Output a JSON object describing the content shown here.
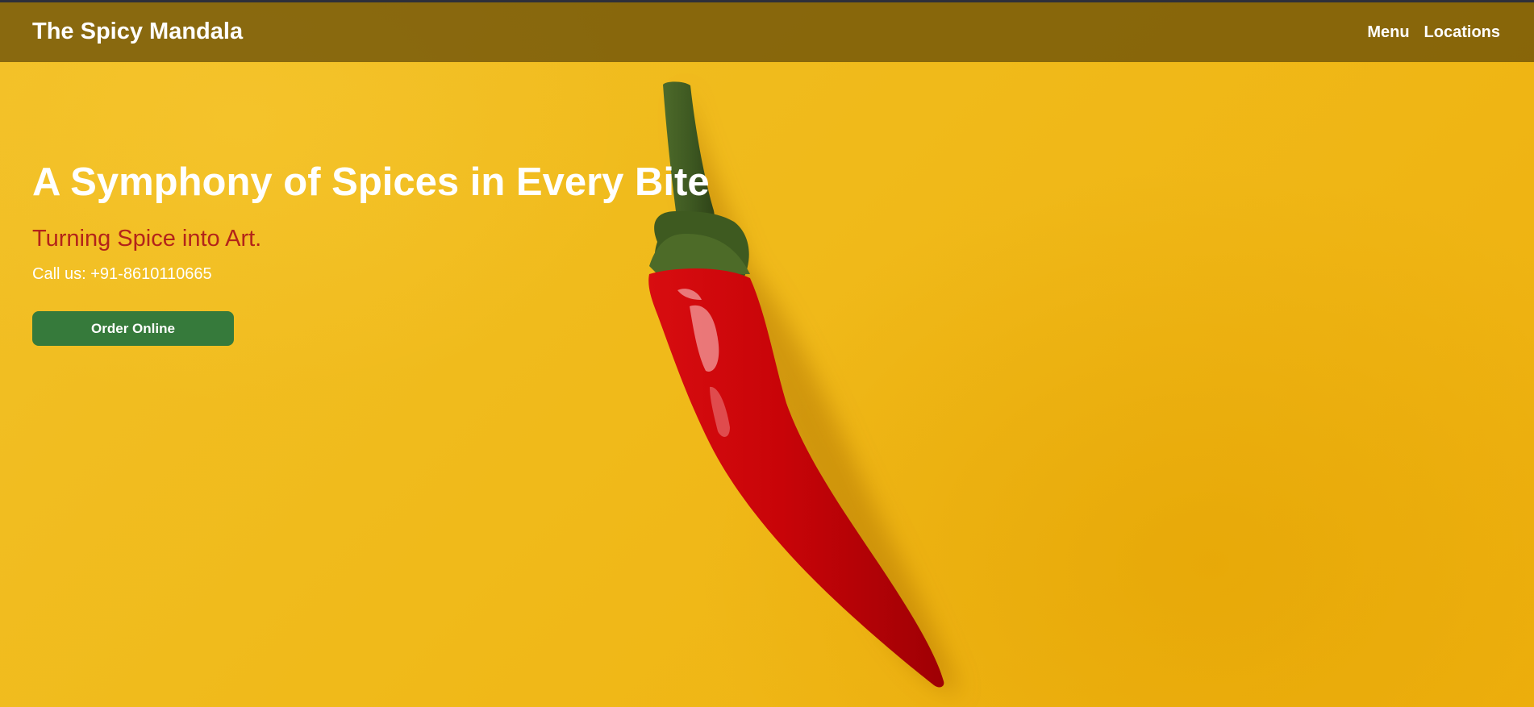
{
  "header": {
    "brand": "The Spicy Mandala",
    "nav": [
      {
        "label": "Menu"
      },
      {
        "label": "Locations"
      }
    ]
  },
  "hero": {
    "headline": "A Symphony of Spices in Every Bite",
    "tagline": "Turning Spice into Art.",
    "phone": "Call us: +91-8610110665",
    "cta_label": "Order Online",
    "image": "red-chili-pepper-on-yellow-background"
  },
  "colors": {
    "background": "#f1bd1c",
    "header_overlay": "#5f4605",
    "tagline": "#b3241a",
    "cta": "#367a3b",
    "text": "#ffffff"
  }
}
